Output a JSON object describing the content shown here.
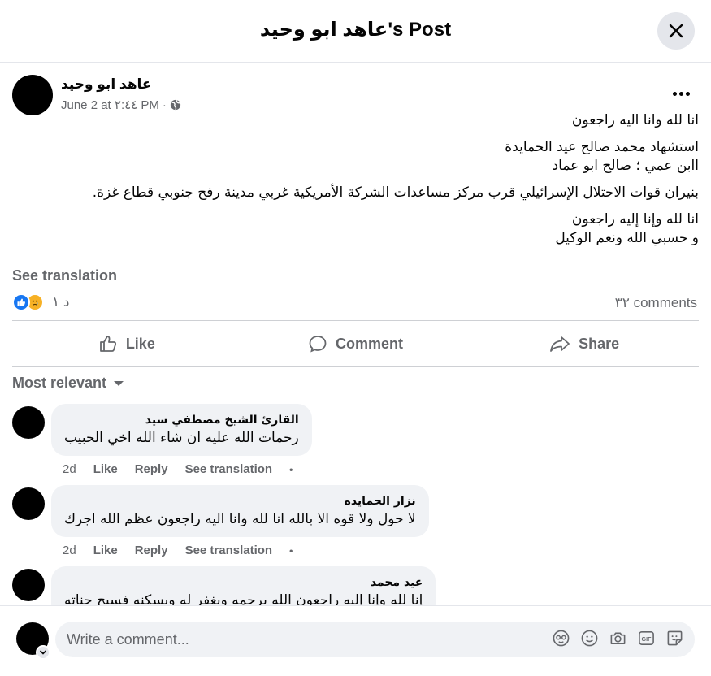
{
  "header": {
    "title": "عاهد ابو وحيد's Post"
  },
  "post": {
    "author": "عاهد ابو وحيد",
    "date": "June 2 at ٢:٤٤ PM",
    "privacy_icon": "globe-icon",
    "paragraphs": [
      "انا لله وانا اليه راجعون",
      "استشهاد محمد صالح عيد الحمايدة\nاابن عمي ؛ صالح ابو عماد",
      "بنيران قوات الاحتلال الإسرائيلي قرب مركز مساعدات الشركة الأمريكية غربي مدينة رفح جنوبي قطاع غزة.",
      "انا لله وإنا إليه راجعون\nو حسبي الله ونعم الوكيل"
    ],
    "see_translation": "See translation",
    "reaction_count": "د ١",
    "comments_count": "٣٢ comments"
  },
  "actions": {
    "like": "Like",
    "comment": "Comment",
    "share": "Share"
  },
  "sort_label": "Most relevant",
  "comments": [
    {
      "name": "القارئ الشيخ مصطفي سيد",
      "text": "رحمات الله عليه ان شاء الله اخي الحبيب",
      "time": "2d",
      "like": "Like",
      "reply": "Reply",
      "see_translation": "See translation"
    },
    {
      "name": "نزار الحمايده",
      "text": "لا حول ولا قوه الا بالله انا لله وانا اليه راجعون عظم الله اجرك",
      "time": "2d",
      "like": "Like",
      "reply": "Reply",
      "see_translation": "See translation"
    },
    {
      "name": "عيد محمد",
      "text": "إنا لله وإنا إليه راجعون الله يرحمه ويغفر له ويسكنه فسيح جناته"
    }
  ],
  "composer": {
    "placeholder": "Write a comment..."
  }
}
